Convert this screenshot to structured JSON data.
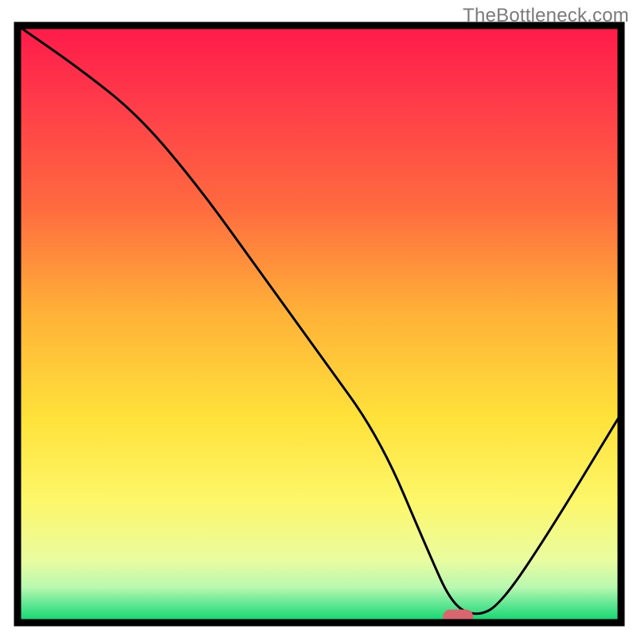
{
  "watermark": "TheBottleneck.com",
  "chart_data": {
    "type": "line",
    "title": "",
    "xlabel": "",
    "ylabel": "",
    "xlim": [
      0,
      100
    ],
    "ylim": [
      0,
      100
    ],
    "grid": false,
    "legend": false,
    "series": [
      {
        "name": "bottleneck-curve",
        "x": [
          0,
          10,
          20,
          30,
          40,
          50,
          60,
          68,
          72,
          76,
          80,
          88,
          100
        ],
        "y": [
          100,
          93,
          85,
          73,
          59,
          45,
          31,
          12,
          3,
          1,
          3,
          15,
          35
        ]
      }
    ],
    "annotations": [
      {
        "name": "marker",
        "shape": "rounded-rect",
        "x": 73,
        "y": 1,
        "color": "#d9666e"
      }
    ],
    "background_gradient": {
      "type": "vertical",
      "stops": [
        {
          "offset": 0.0,
          "color": "#ff1b4a"
        },
        {
          "offset": 0.12,
          "color": "#ff3a4a"
        },
        {
          "offset": 0.3,
          "color": "#ff6a3f"
        },
        {
          "offset": 0.48,
          "color": "#ffb138"
        },
        {
          "offset": 0.66,
          "color": "#ffe23a"
        },
        {
          "offset": 0.8,
          "color": "#fdf76a"
        },
        {
          "offset": 0.9,
          "color": "#e9fca0"
        },
        {
          "offset": 0.945,
          "color": "#b9f8b0"
        },
        {
          "offset": 0.975,
          "color": "#5fe693"
        },
        {
          "offset": 1.0,
          "color": "#17d873"
        }
      ]
    },
    "frame_color": "#000000",
    "curve_color": "#000000",
    "curve_width": 3
  }
}
